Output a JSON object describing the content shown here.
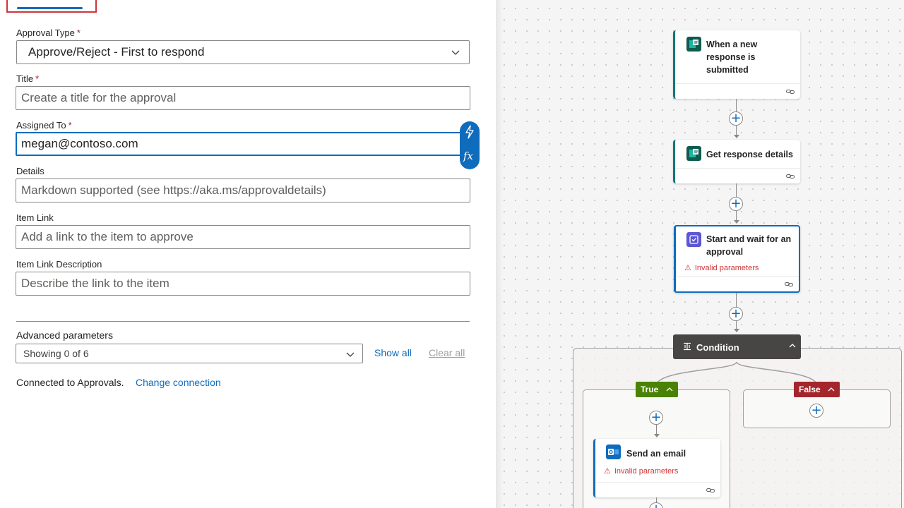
{
  "form": {
    "approval_type": {
      "label": "Approval Type",
      "required": "*",
      "value": "Approve/Reject - First to respond"
    },
    "title": {
      "label": "Title",
      "required": "*",
      "placeholder": "Create a title for the approval"
    },
    "assigned_to": {
      "label": "Assigned To",
      "required": "*",
      "value": "megan@contoso.com"
    },
    "details": {
      "label": "Details",
      "placeholder": "Markdown supported (see https://aka.ms/approvaldetails)"
    },
    "item_link": {
      "label": "Item Link",
      "placeholder": "Add a link to the item to approve"
    },
    "item_link_description": {
      "label": "Item Link Description",
      "placeholder": "Describe the link to the item"
    },
    "expression_tools": {
      "dynamic_icon": "lightning-icon",
      "fx_label": "fx"
    },
    "advanced": {
      "label": "Advanced parameters",
      "select_value": "Showing 0 of 6",
      "show_all": "Show all",
      "clear_all": "Clear all"
    },
    "connection": {
      "text": "Connected to Approvals.",
      "change_link": "Change connection"
    }
  },
  "flow": {
    "trigger": {
      "title": "When a new response is submitted",
      "icon": "forms-icon"
    },
    "get_details": {
      "title": "Get response details",
      "icon": "forms-icon"
    },
    "approval": {
      "title": "Start and wait for an approval",
      "icon": "approvals-icon",
      "warning": "Invalid parameters"
    },
    "condition": {
      "title": "Condition"
    },
    "true_branch": {
      "label": "True",
      "color": "#498205"
    },
    "false_branch": {
      "label": "False",
      "color": "#a4262c"
    },
    "send_email": {
      "title": "Send an email",
      "icon": "outlook-icon",
      "warning": "Invalid parameters"
    }
  },
  "colors": {
    "accent": "#0f6cbd",
    "forms_teal": "#0e7878",
    "error": "#d13438"
  }
}
